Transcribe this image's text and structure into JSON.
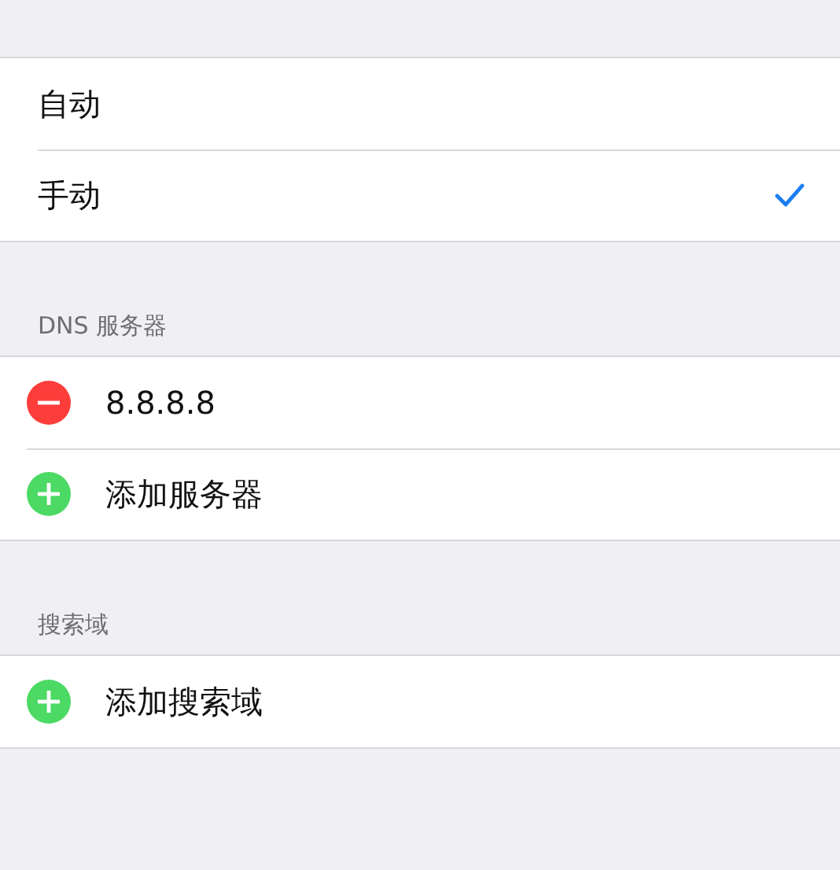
{
  "mode_options": [
    {
      "label": "自动",
      "selected": false
    },
    {
      "label": "手动",
      "selected": true
    }
  ],
  "sections": [
    {
      "header": "DNS 服务器",
      "rows": [
        {
          "kind": "remove",
          "label": "8.8.8.8"
        },
        {
          "kind": "add",
          "label": "添加服务器"
        }
      ]
    },
    {
      "header": "搜索域",
      "rows": [
        {
          "kind": "add",
          "label": "添加搜索域"
        }
      ]
    }
  ]
}
